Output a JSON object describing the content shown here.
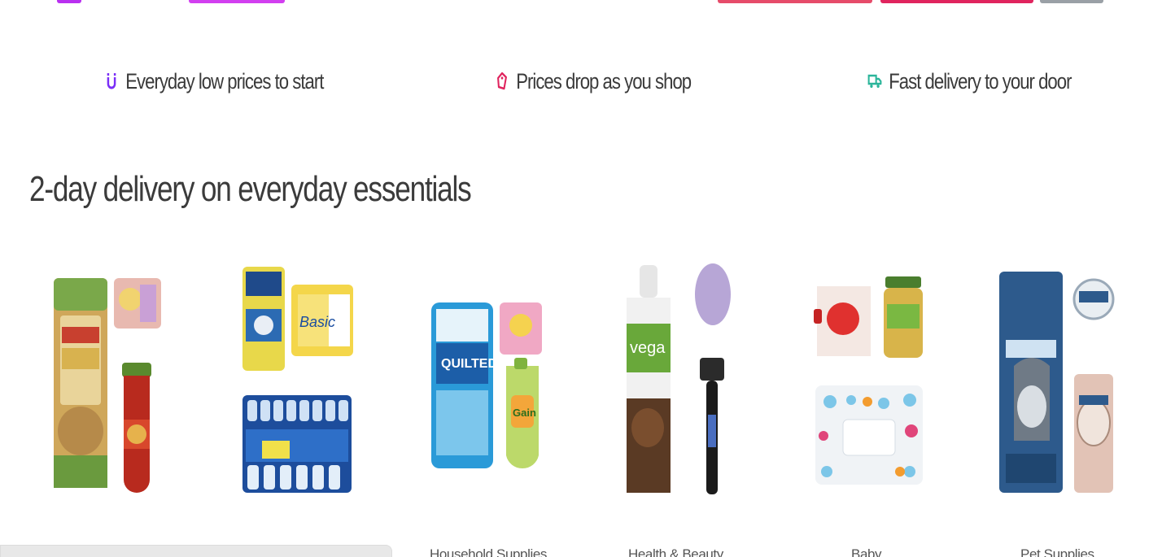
{
  "benefits": [
    {
      "label": "Everyday low prices to start",
      "icon": "magnet-icon",
      "color": "#7b2ff7"
    },
    {
      "label": "Prices drop as you shop",
      "icon": "tag-icon",
      "color": "#e0245e"
    },
    {
      "label": "Fast delivery to your door",
      "icon": "truck-icon",
      "color": "#2bb59a"
    }
  ],
  "section": {
    "title": "2-day delivery on everyday essentials"
  },
  "categories": [
    {
      "label": ""
    },
    {
      "label": ""
    },
    {
      "label": "Household Supplies"
    },
    {
      "label": "Health & Beauty"
    },
    {
      "label": "Baby"
    },
    {
      "label": "Pet Supplies"
    }
  ],
  "colors": {
    "accent_purple": "#b92ff0",
    "accent_red": "#e0245e",
    "accent_teal": "#2bb59a"
  }
}
